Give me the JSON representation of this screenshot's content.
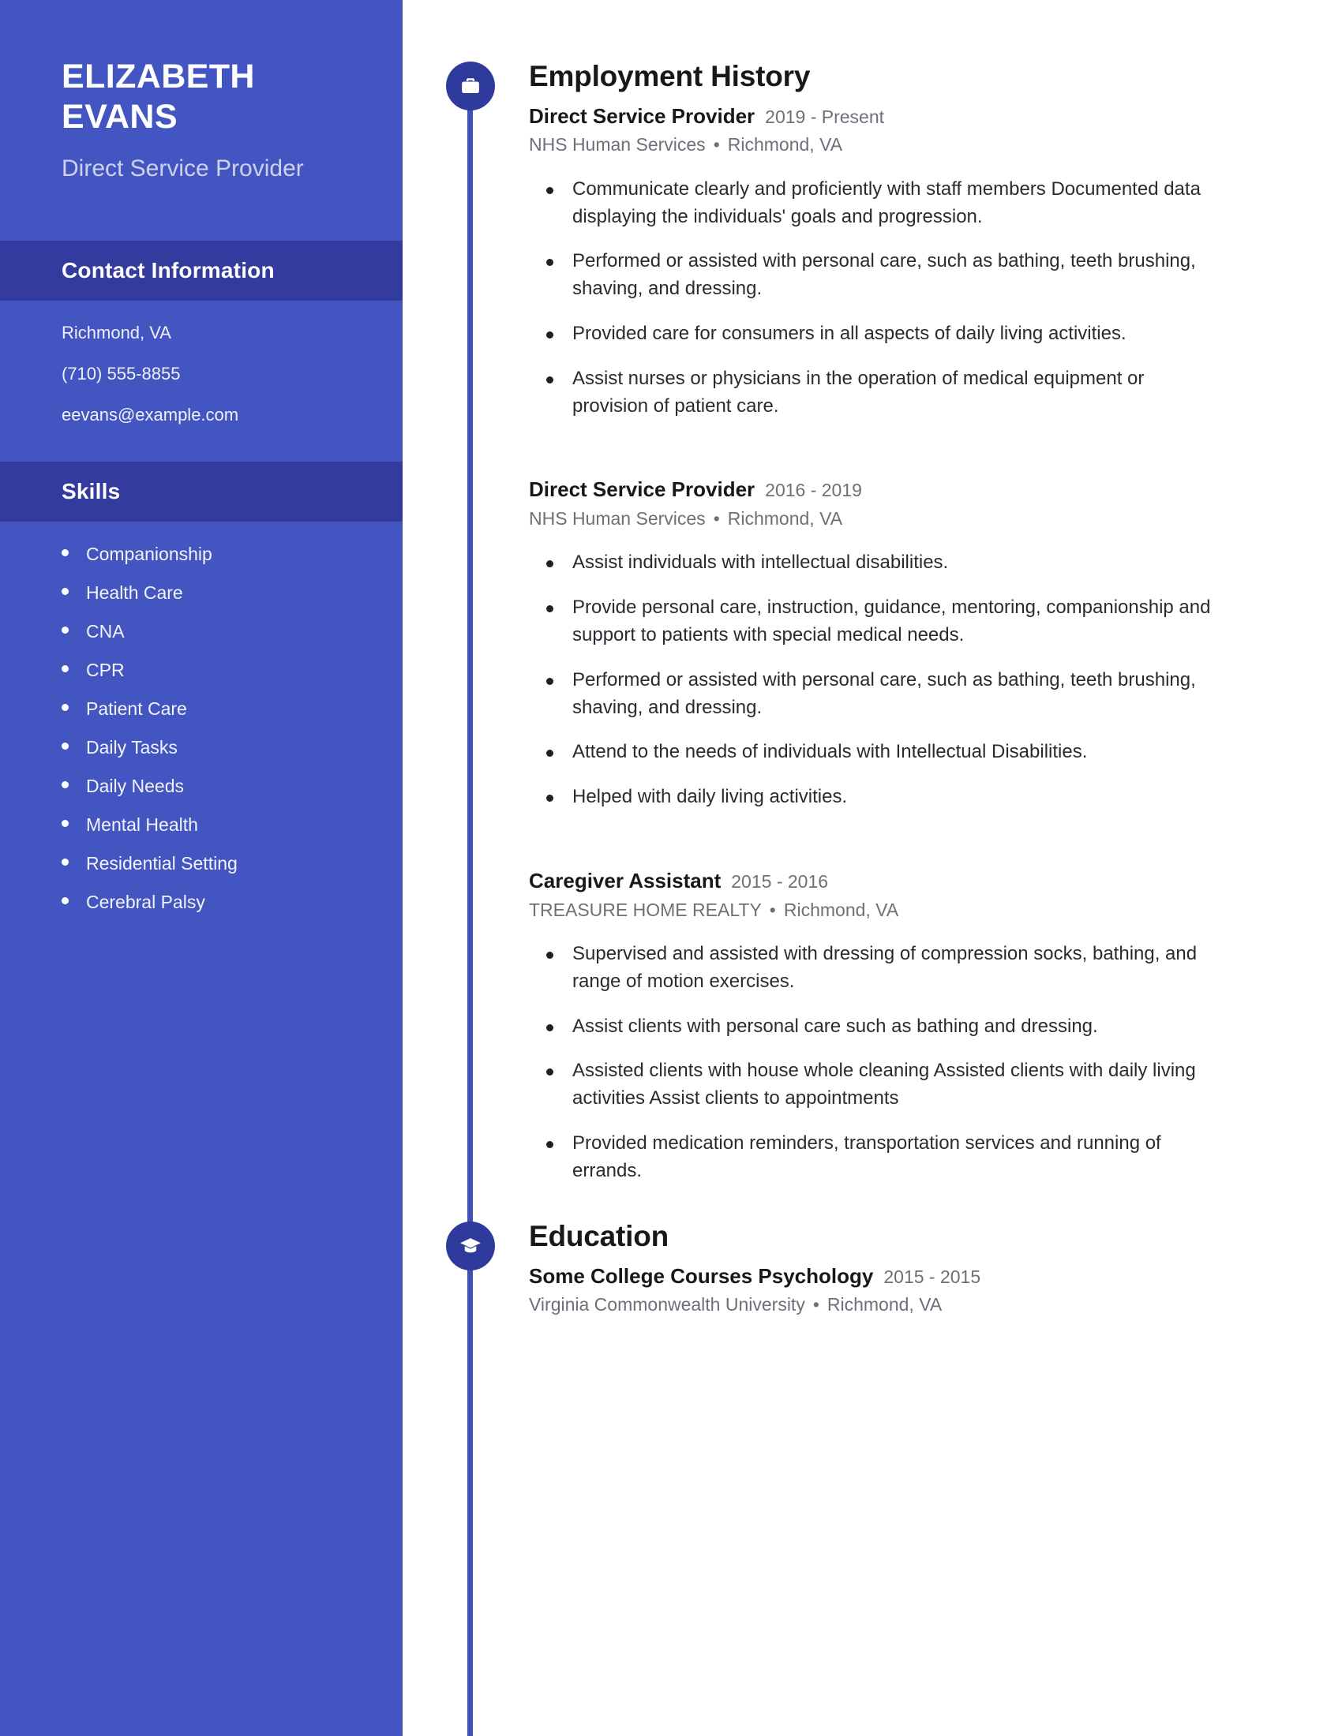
{
  "theme": {
    "sidebar_bg": "#4355c0",
    "sidebar_band_bg": "#333b9e",
    "accent": "#3f51b5",
    "icon_bg": "#2e3a9c",
    "text_dark": "#17181c",
    "text_muted": "#6d7078"
  },
  "sidebar": {
    "name_first": "ELIZABETH",
    "name_last": "EVANS",
    "role": "Direct Service Provider",
    "contact_heading": "Contact Information",
    "contact": [
      "Richmond, VA",
      "(710) 555-8855",
      "eevans@example.com"
    ],
    "skills_heading": "Skills",
    "skills": [
      "Companionship",
      "Health Care",
      "CNA",
      "CPR",
      "Patient Care",
      "Daily Tasks",
      "Daily Needs",
      "Mental Health",
      "Residential Setting",
      "Cerebral Palsy"
    ]
  },
  "sections": {
    "employment": {
      "title": "Employment History",
      "icon": "briefcase-icon",
      "entries": [
        {
          "title": "Direct Service Provider",
          "dates": "2019 - Present",
          "employer": "NHS Human Services",
          "location": "Richmond, VA",
          "bullets": [
            "Communicate clearly and proficiently with staff members Documented data displaying the individuals' goals and progression.",
            "Performed or assisted with personal care, such as bathing, teeth brushing, shaving, and dressing.",
            "Provided care for consumers in all aspects of daily living activities.",
            "Assist nurses or physicians in the operation of medical equipment or provision of patient care."
          ]
        },
        {
          "title": "Direct Service Provider",
          "dates": "2016 - 2019",
          "employer": "NHS Human Services",
          "location": "Richmond, VA",
          "bullets": [
            "Assist individuals with intellectual disabilities.",
            "Provide personal care, instruction, guidance, mentoring, companionship and support to patients with special medical needs.",
            "Performed or assisted with personal care, such as bathing, teeth brushing, shaving, and dressing.",
            "Attend to the needs of individuals with Intellectual Disabilities.",
            "Helped with daily living activities."
          ]
        },
        {
          "title": "Caregiver Assistant",
          "dates": "2015 - 2016",
          "employer": "TREASURE HOME REALTY",
          "location": "Richmond, VA",
          "bullets": [
            "Supervised and assisted with dressing of compression socks, bathing, and range of motion exercises.",
            "Assist clients with personal care such as bathing and dressing.",
            "Assisted clients with house whole cleaning Assisted clients with daily living activities Assist clients to appointments",
            "Provided medication reminders, transportation services and running of errands."
          ]
        }
      ]
    },
    "education": {
      "title": "Education",
      "icon": "graduation-cap-icon",
      "entries": [
        {
          "title": "Some College Courses Psychology",
          "dates": "2015 - 2015",
          "employer": "Virginia Commonwealth University",
          "location": "Richmond, VA",
          "bullets": []
        }
      ]
    }
  },
  "separator": "•"
}
